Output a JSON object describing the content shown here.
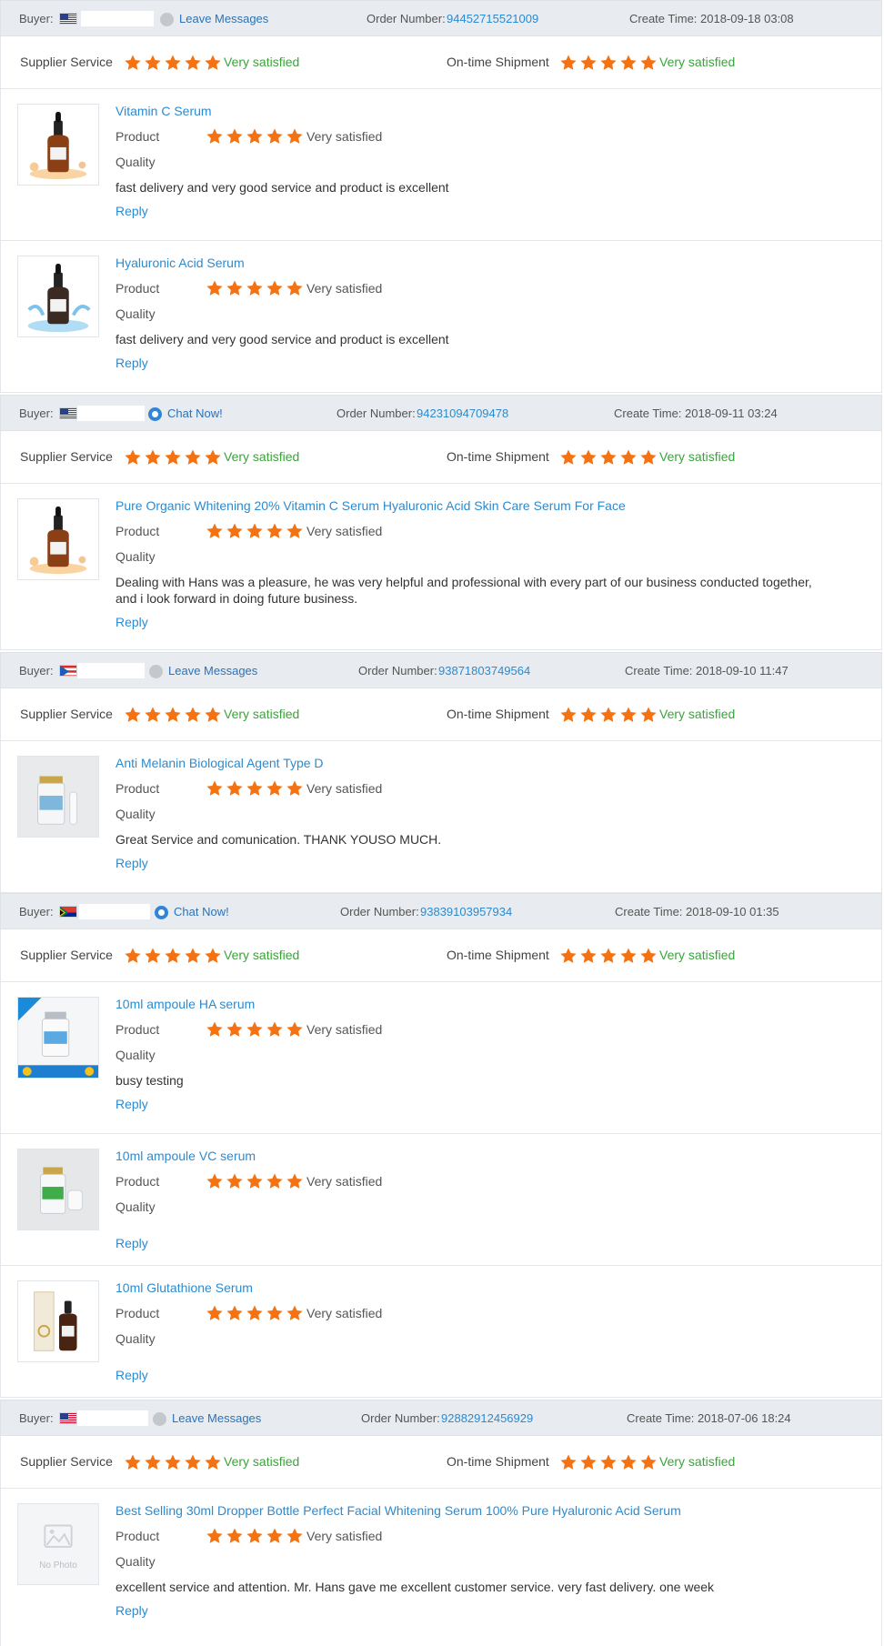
{
  "labels": {
    "buyer": "Buyer:",
    "order_number": "Order Number:",
    "create_time": "Create Time:",
    "supplier_service": "Supplier Service",
    "ontime_shipment": "On-time Shipment",
    "product": "Product",
    "quality": "Quality",
    "reply": "Reply"
  },
  "colors": {
    "star": "#f47211",
    "satisfied": "#3aa43a",
    "link": "#2b8bd0"
  },
  "rating_max": 5,
  "orders": [
    {
      "flag": "us-flag-icon",
      "message_link": "Leave Messages",
      "message_icon": "grey",
      "order_number": "94452715521009",
      "create_time": "2018-09-18 03:08",
      "supplier_service": {
        "stars": 5,
        "text": "Very satisfied"
      },
      "ontime_shipment": {
        "stars": 5,
        "text": "Very satisfied"
      },
      "items": [
        {
          "name": "Vitamin C Serum",
          "image": "dropper-bottle-splash-orange",
          "product_rating": {
            "stars": 5,
            "text": "Very satisfied"
          },
          "review": "fast delivery and very good service and product is excellent"
        },
        {
          "name": "Hyaluronic Acid Serum",
          "image": "dropper-bottle-splash-blue",
          "product_rating": {
            "stars": 5,
            "text": "Very satisfied"
          },
          "review": "fast delivery and very good service and product is excellent"
        }
      ]
    },
    {
      "flag": "us-flag-icon",
      "message_link": "Chat Now!",
      "message_icon": "blue",
      "order_number": "94231094709478",
      "create_time": "2018-09-11 03:24",
      "supplier_service": {
        "stars": 5,
        "text": "Very satisfied"
      },
      "ontime_shipment": {
        "stars": 5,
        "text": "Very satisfied"
      },
      "items": [
        {
          "name": "Pure Organic Whitening 20% Vitamin C Serum Hyaluronic Acid Skin Care Serum For Face",
          "image": "dropper-bottle-splash-orange",
          "product_rating": {
            "stars": 5,
            "text": "Very satisfied"
          },
          "review": "Dealing with Hans was a pleasure, he was very helpful and professional with every part of our business conducted together, and i look forward in doing future business."
        }
      ]
    },
    {
      "flag": "pr-flag-icon",
      "message_link": "Leave Messages",
      "message_icon": "grey",
      "order_number": "93871803749564",
      "create_time": "2018-09-10 11:47",
      "supplier_service": {
        "stars": 5,
        "text": "Very satisfied"
      },
      "ontime_shipment": {
        "stars": 5,
        "text": "Very satisfied"
      },
      "items": [
        {
          "name": "Anti Melanin Biological Agent Type D",
          "image": "vial-and-ampoule",
          "product_rating": {
            "stars": 5,
            "text": "Very satisfied"
          },
          "review": "Great Service and comunication. THANK YOUSO MUCH."
        }
      ]
    },
    {
      "flag": "za-flag-icon",
      "message_link": "Chat Now!",
      "message_icon": "blue",
      "order_number": "93839103957934",
      "create_time": "2018-09-10 01:35",
      "supplier_service": {
        "stars": 5,
        "text": "Very satisfied"
      },
      "ontime_shipment": {
        "stars": 5,
        "text": "Very satisfied"
      },
      "items": [
        {
          "name": "10ml ampoule HA serum",
          "image": "vial-blue-label-banner",
          "product_rating": {
            "stars": 5,
            "text": "Very satisfied"
          },
          "review": "busy testing"
        },
        {
          "name": "10ml ampoule VC serum",
          "image": "vial-green-label",
          "product_rating": {
            "stars": 5,
            "text": "Very satisfied"
          },
          "review": ""
        },
        {
          "name": "10ml Glutathione Serum",
          "image": "dropper-bottle-with-box",
          "product_rating": {
            "stars": 5,
            "text": "Very satisfied"
          },
          "review": ""
        }
      ]
    },
    {
      "flag": "us-flag-icon",
      "message_link": "Leave Messages",
      "message_icon": "grey",
      "order_number": "92882912456929",
      "create_time": "2018-07-06 18:24",
      "supplier_service": {
        "stars": 5,
        "text": "Very satisfied"
      },
      "ontime_shipment": {
        "stars": 5,
        "text": "Very satisfied"
      },
      "items": [
        {
          "name": "Best Selling 30ml Dropper Bottle Perfect Facial Whitening Serum 100% Pure Hyaluronic Acid Serum",
          "image": "no-photo-placeholder",
          "image_text": "No Photo",
          "product_rating": {
            "stars": 5,
            "text": "Very satisfied"
          },
          "review": "excellent service and attention. Mr. Hans gave me excellent customer service. very fast delivery. one week"
        }
      ]
    }
  ]
}
